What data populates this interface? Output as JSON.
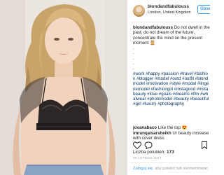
{
  "post": {
    "username": "blondandfabulouss",
    "location": "London, United Kingdom",
    "follow_label": "Obse",
    "caption_text": "Do not dwell in the past, do not dream of the future, concentrate the mind on the present moment 💆🏼",
    "caption_dots": [
      ".",
      ".",
      ".",
      ".",
      "."
    ],
    "hashtags": "#work #happy #passion #travel #fashion #blogger #model #ootd #outfit #blondmodel #motivation #style #modal #lingeriemodel #fashiongirl #instagood #instabeauty #love #goals #dreams #fitn #whatwear #photomodel #beauty #beautiful #girl #luxury #photography"
  },
  "comments": [
    {
      "user": "jovanabaco",
      "text": "Like the top 😍"
    },
    {
      "user": "imranqaisarsheikh",
      "text": "Ur beauty increase with cover dress"
    }
  ],
  "likes": {
    "label": "Liczba polubień:",
    "count": "173"
  },
  "date": "30 LUTEGO 2017",
  "login": {
    "link": "Zaloguj się",
    "rest": ", aby polubić lub skomentować"
  },
  "icons": [
    "heart-icon",
    "comment-icon",
    "bookmark-icon"
  ],
  "colors": {
    "link": "#3897f0",
    "hashtag": "#003569",
    "muted": "#999999"
  }
}
